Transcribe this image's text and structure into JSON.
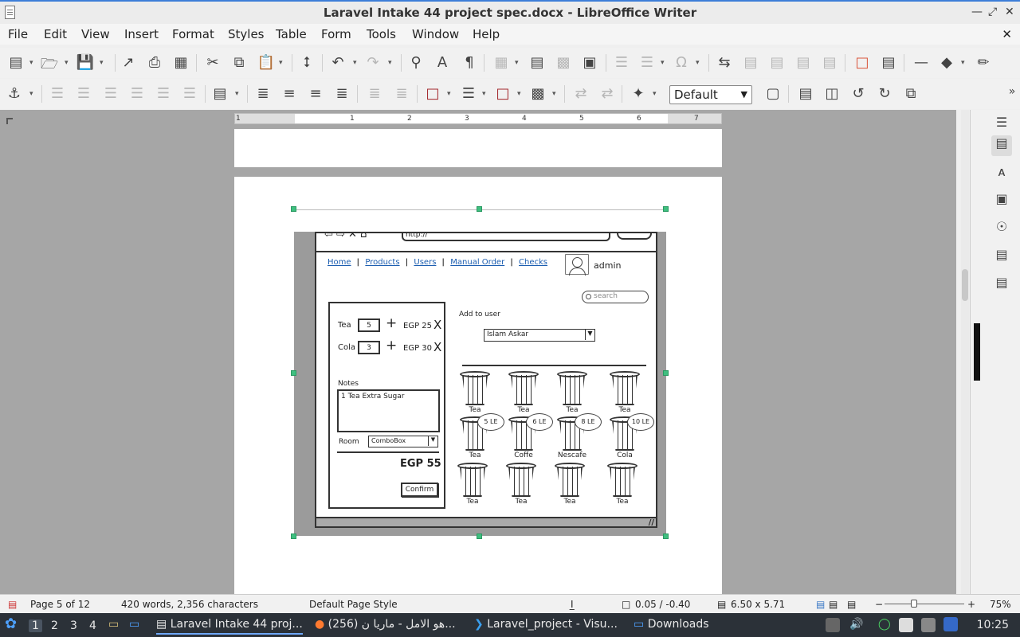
{
  "window": {
    "title": "Laravel Intake 44 project spec.docx - LibreOffice Writer"
  },
  "menu": [
    "File",
    "Edit",
    "View",
    "Insert",
    "Format",
    "Styles",
    "Table",
    "Form",
    "Tools",
    "Window",
    "Help"
  ],
  "toolbar": {
    "paragraph_style": "Default"
  },
  "ruler": {
    "ticks": [
      "1",
      "1",
      "2",
      "3",
      "4",
      "5",
      "6",
      "7"
    ]
  },
  "mockup": {
    "url": "http://",
    "nav": [
      "Home",
      "Products",
      "Users",
      "Manual Order",
      "Checks"
    ],
    "user": "admin",
    "search_placeholder": "search",
    "order_items": [
      {
        "name": "Tea",
        "qty": "5",
        "price": "EGP 25",
        "remove": "X"
      },
      {
        "name": "Cola",
        "qty": "3",
        "price": "EGP 30",
        "remove": "X"
      }
    ],
    "notes_label": "Notes",
    "notes_value": "1 Tea Extra Sugar",
    "room_label": "Room",
    "room_value": "ComboBox",
    "total": "EGP 55",
    "confirm": "Confirm",
    "add_to_user": "Add to user",
    "selected_user": "Islam Askar",
    "products": [
      {
        "label": "Tea",
        "badge": ""
      },
      {
        "label": "Tea",
        "badge": ""
      },
      {
        "label": "Tea",
        "badge": ""
      },
      {
        "label": "Tea",
        "badge": ""
      },
      {
        "label": "Tea",
        "badge": "5 LE"
      },
      {
        "label": "Coffe",
        "badge": "6 LE"
      },
      {
        "label": "Nescafe",
        "badge": "8 LE"
      },
      {
        "label": "Cola",
        "badge": "10 LE"
      },
      {
        "label": "Tea",
        "badge": ""
      },
      {
        "label": "Tea",
        "badge": ""
      },
      {
        "label": "Tea",
        "badge": ""
      },
      {
        "label": "Tea",
        "badge": ""
      }
    ]
  },
  "status": {
    "page": "Page 5 of 12",
    "words": "420 words, 2,356 characters",
    "page_style": "Default Page Style",
    "position": "0.05 / -0.40",
    "size": "6.50 x 5.71",
    "zoom": "75%"
  },
  "taskbar": {
    "workspaces": [
      "1",
      "2",
      "3",
      "4"
    ],
    "tasks": [
      "Laravel Intake 44 proj...",
      "(256) هو الامل - ماريا ن...",
      "Laravel_project - Visu...",
      "Downloads"
    ],
    "clock": "10:25"
  }
}
